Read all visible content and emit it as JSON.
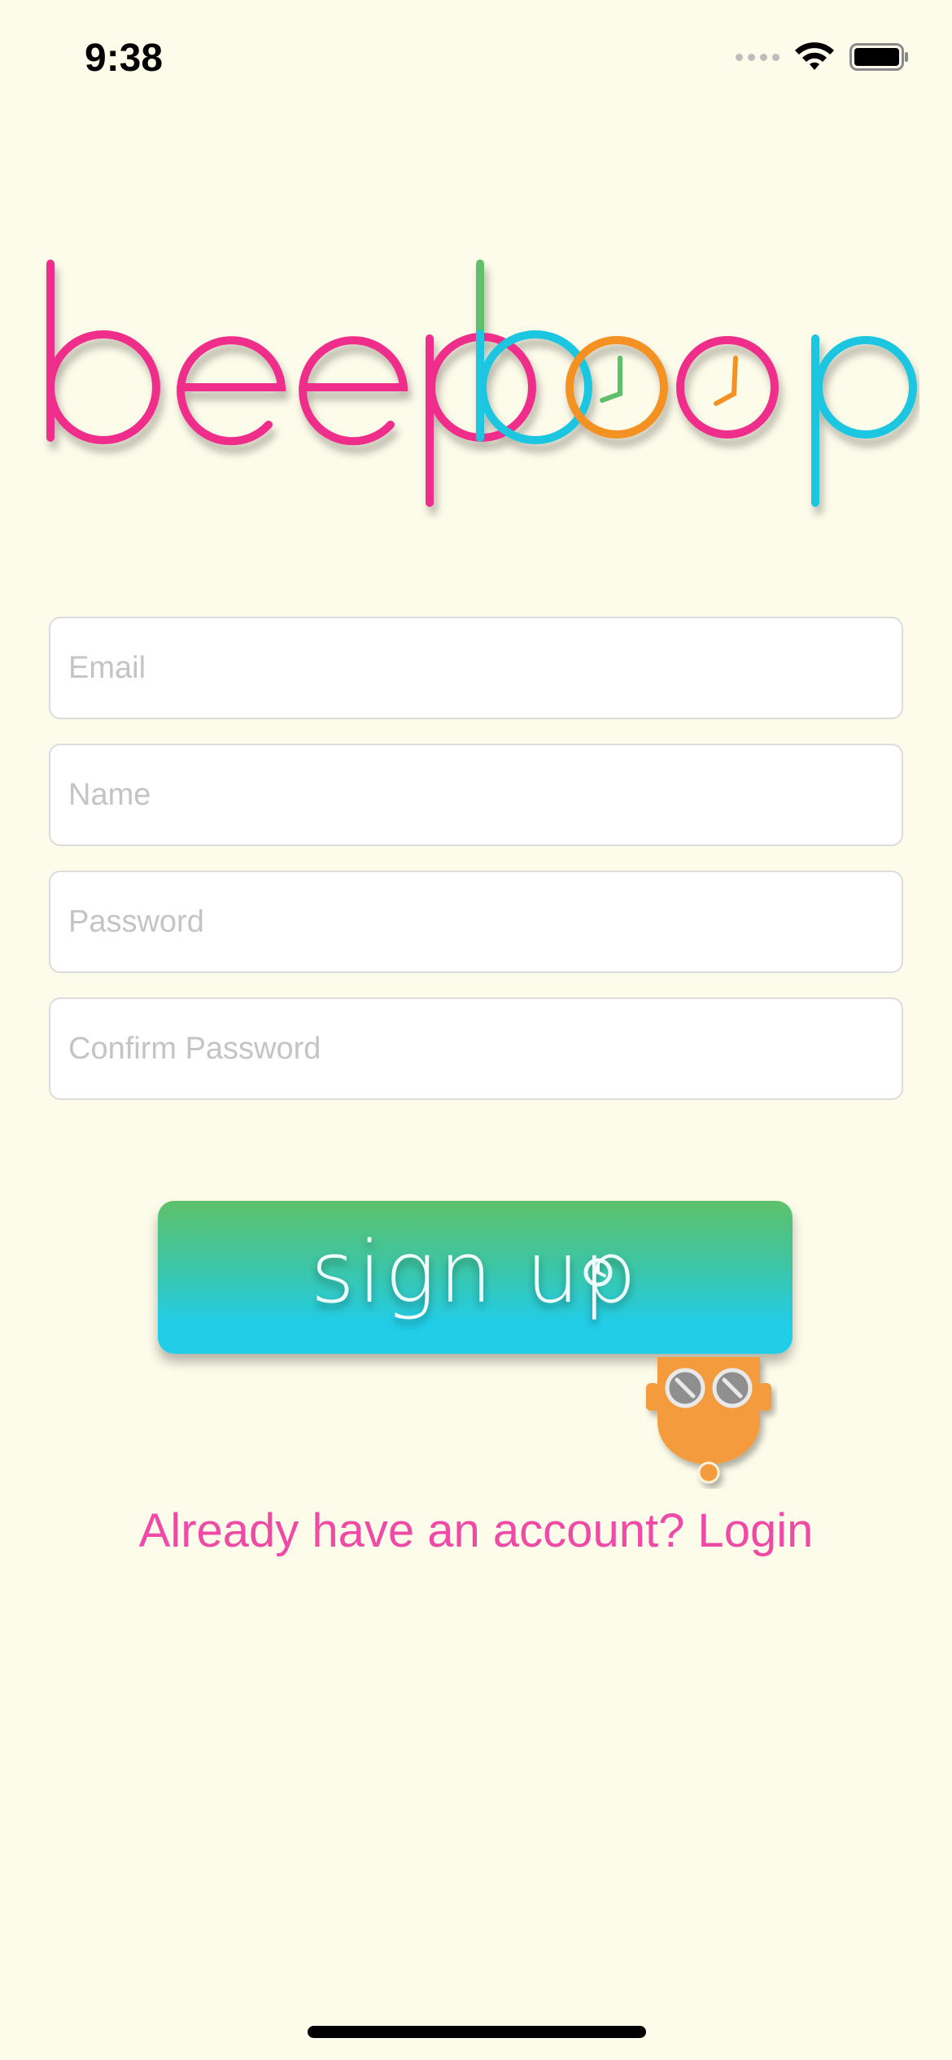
{
  "status_bar": {
    "time": "9:38"
  },
  "logo": {
    "text": "beepboop",
    "colors": {
      "pink": "#ee2f8a",
      "cyan": "#1ec6e0",
      "orange": "#f39222",
      "green": "#5fbf6a"
    }
  },
  "form": {
    "email_placeholder": "Email",
    "name_placeholder": "Name",
    "password_placeholder": "Password",
    "confirm_password_placeholder": "Confirm Password"
  },
  "signup_button": {
    "label": "sign up"
  },
  "login_link": {
    "label": "Already have an account? Login"
  },
  "colors": {
    "background": "#fdfbe9",
    "accent_pink": "#ee4aa6",
    "button_top": "#5dc16a",
    "button_bottom": "#22cde8",
    "mascot_orange": "#f39b3c"
  },
  "icons": {
    "signal": "cellular-signal-icon",
    "wifi": "wifi-icon",
    "battery": "battery-icon",
    "mascot": "robot-mascot-icon",
    "clock": "clock-icon"
  }
}
